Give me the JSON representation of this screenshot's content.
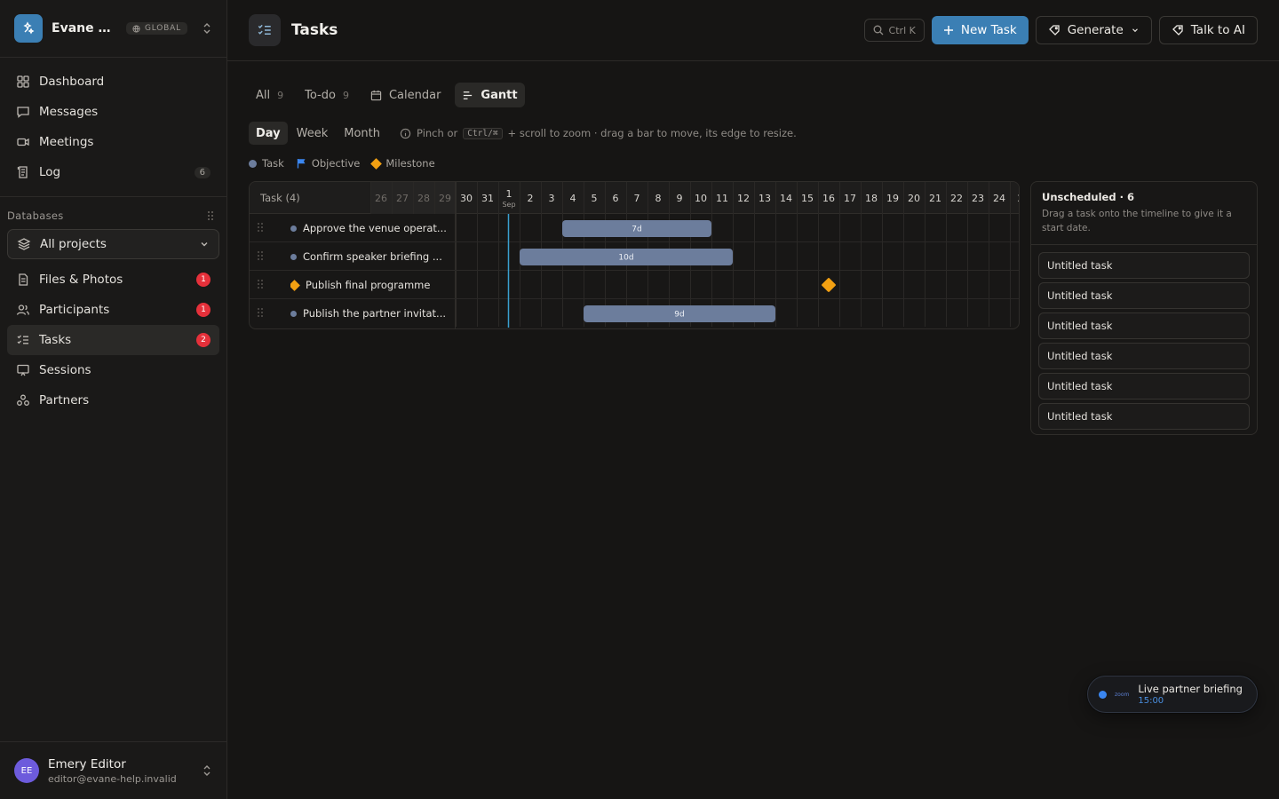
{
  "workspace": {
    "name": "Evane He...",
    "scope": "GLOBAL"
  },
  "nav": [
    {
      "label": "Dashboard",
      "icon": "grid-icon",
      "count": ""
    },
    {
      "label": "Messages",
      "icon": "message-icon",
      "count": ""
    },
    {
      "label": "Meetings",
      "icon": "video-icon",
      "count": ""
    },
    {
      "label": "Log",
      "icon": "log-icon",
      "count": "6"
    }
  ],
  "databases": {
    "heading": "Databases",
    "selector": "All projects",
    "items": [
      {
        "label": "Files & Photos",
        "badge": "1"
      },
      {
        "label": "Participants",
        "badge": "1"
      },
      {
        "label": "Tasks",
        "badge": "2"
      },
      {
        "label": "Sessions",
        "badge": ""
      },
      {
        "label": "Partners",
        "badge": ""
      }
    ]
  },
  "user": {
    "initials": "EE",
    "name": "Emery Editor",
    "email": "editor@evane-help.invalid"
  },
  "topbar": {
    "title": "Tasks",
    "search_shortcut": "Ctrl K",
    "new_task": "New Task",
    "generate": "Generate",
    "talk_ai": "Talk to AI"
  },
  "views": [
    {
      "label": "All",
      "count": "9"
    },
    {
      "label": "To-do",
      "count": "9"
    },
    {
      "label": "Calendar",
      "count": ""
    },
    {
      "label": "Gantt",
      "count": ""
    }
  ],
  "zoom": {
    "levels": [
      "Day",
      "Week",
      "Month"
    ],
    "active": "Day",
    "hint_pre": "Pinch or",
    "hint_key": "Ctrl/⌘",
    "hint_post": "+ scroll to zoom · drag a bar to move, its edge to resize."
  },
  "legend": {
    "task": "Task",
    "objective": "Objective",
    "milestone": "Milestone"
  },
  "gantt": {
    "column_title": "Task (4)",
    "days": [
      "26",
      "27",
      "28",
      "29",
      "30",
      "31",
      "1",
      "2",
      "3",
      "4",
      "5",
      "6",
      "7",
      "8",
      "9",
      "10",
      "11",
      "12",
      "13",
      "14",
      "15",
      "16",
      "17",
      "18",
      "19",
      "20",
      "21",
      "22",
      "23",
      "24",
      "2"
    ],
    "month_label": "Sep",
    "today_index": 6,
    "past_count": 4,
    "tasks": [
      {
        "name": "Approve the venue operat...",
        "kind": "task",
        "start": 9,
        "end": 16,
        "label": "7d"
      },
      {
        "name": "Confirm speaker briefing ...",
        "kind": "task",
        "start": 7,
        "end": 17,
        "label": "10d"
      },
      {
        "name": "Publish final programme",
        "kind": "milestone",
        "start": 21,
        "end": 21,
        "label": ""
      },
      {
        "name": "Publish the partner invitat...",
        "kind": "task",
        "start": 10,
        "end": 19,
        "label": "9d"
      }
    ]
  },
  "unscheduled": {
    "title": "Unscheduled · 6",
    "subtitle": "Drag a task onto the timeline to give it a start date.",
    "items": [
      "Untitled task",
      "Untitled task",
      "Untitled task",
      "Untitled task",
      "Untitled task",
      "Untitled task"
    ]
  },
  "live": {
    "title": "Live partner briefing",
    "time": "15:00",
    "provider": "zoom"
  },
  "colors": {
    "accent": "#3b7fb4",
    "bar": "#6c7d9c",
    "milestone": "#f2a012",
    "today": "#3aa0d0",
    "badge": "#e5303a"
  }
}
